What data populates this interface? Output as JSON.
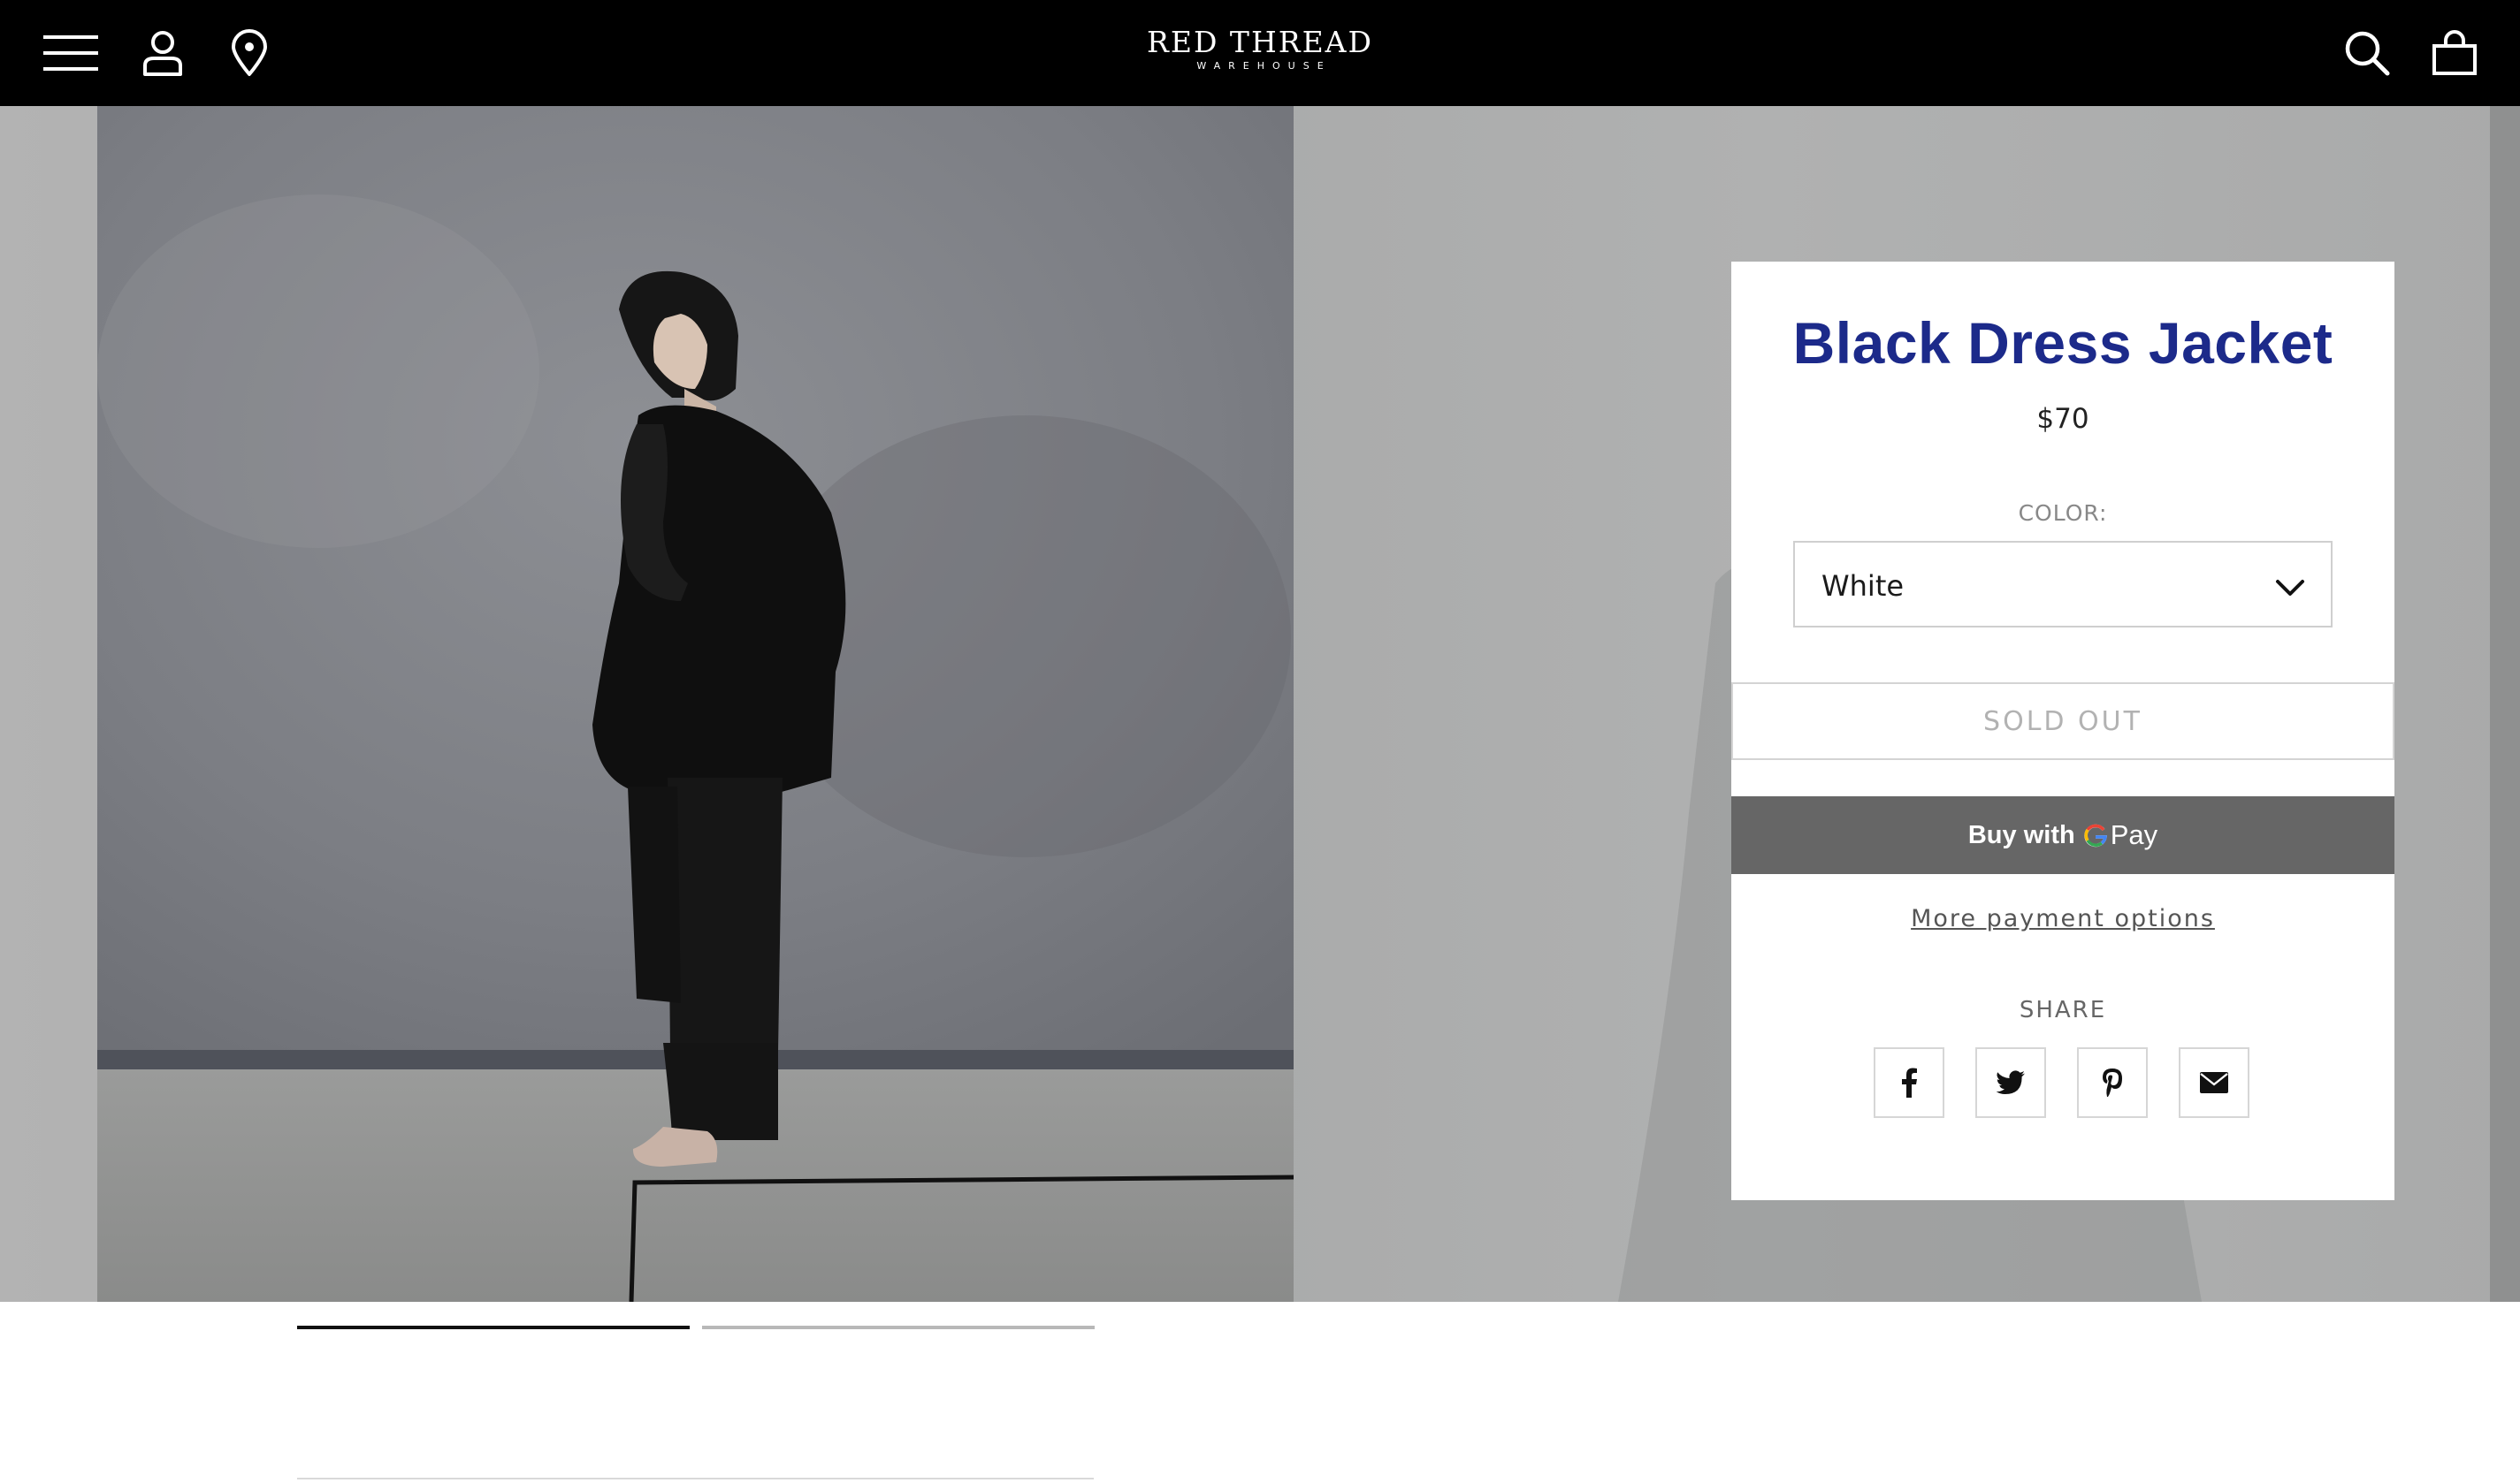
{
  "header": {
    "logo_main": "RED THREAD",
    "logo_sub": "WAREHOUSE",
    "icons": [
      "menu-icon",
      "account-icon",
      "location-icon",
      "search-icon",
      "cart-icon"
    ],
    "background": "#000000"
  },
  "product": {
    "title": "Black Dress Jacket",
    "price": "$70",
    "color_label": "COLOR:",
    "color_value": "White",
    "sold_out_label": "SOLD OUT",
    "buy_with_label": "Buy with",
    "pay_label": "Pay",
    "more_payment_label": "More payment options",
    "share_label": "SHARE",
    "share_icons": [
      "facebook-icon",
      "twitter-icon",
      "pinterest-icon",
      "email-icon"
    ],
    "title_color": "#1c2a8a"
  },
  "gallery": {
    "slide_count": 2,
    "active_slide": 1
  }
}
